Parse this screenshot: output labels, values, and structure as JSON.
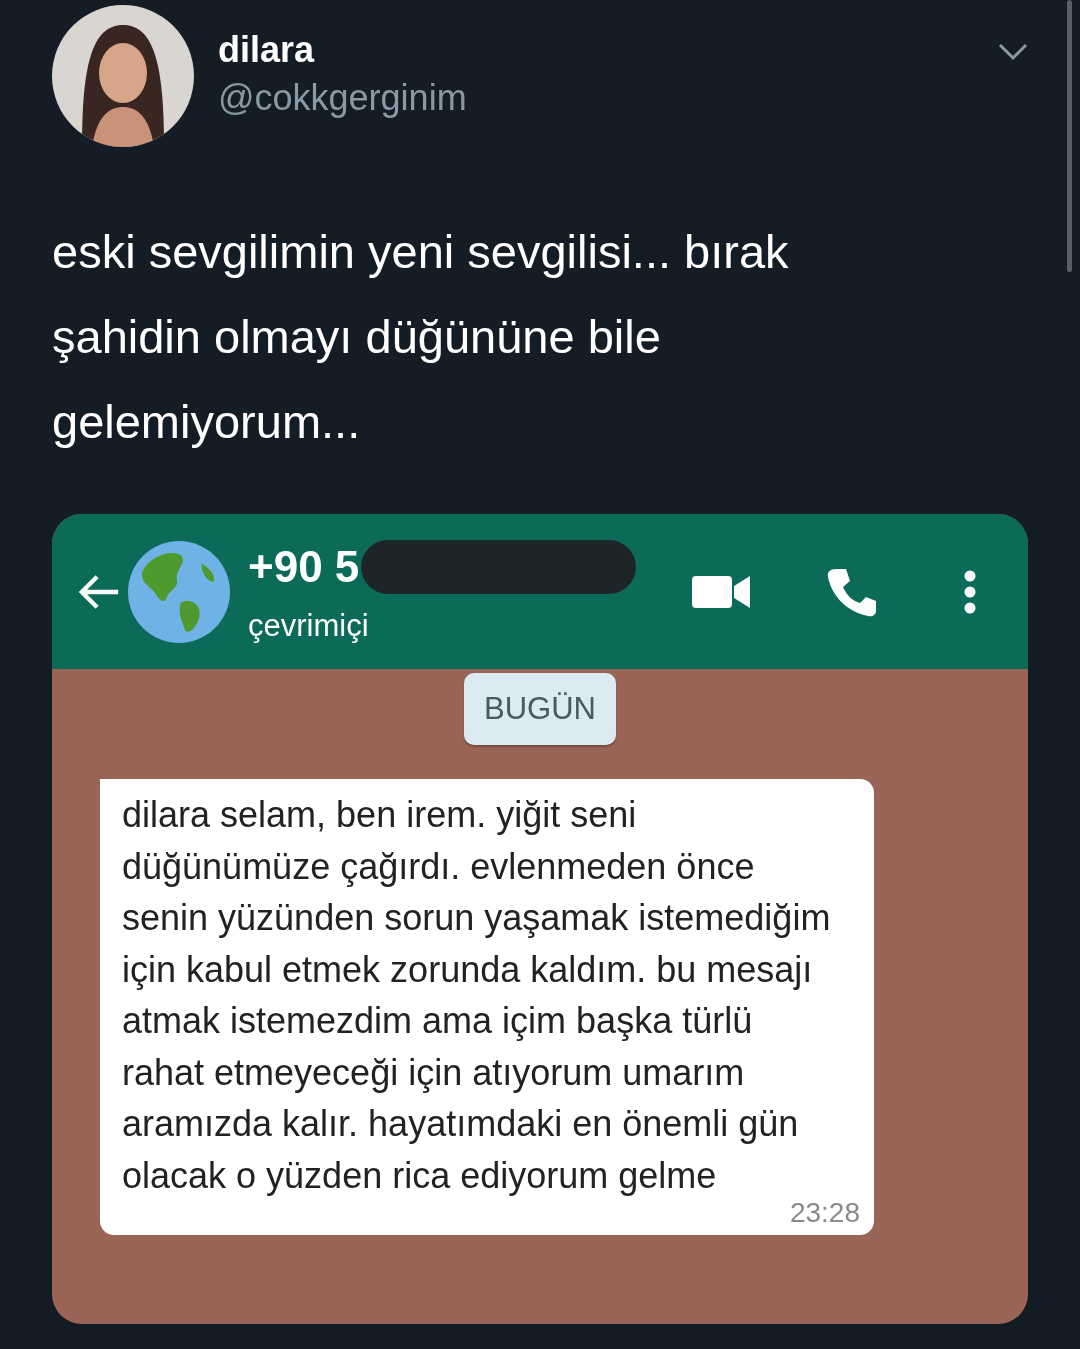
{
  "tweet": {
    "name": "dilara",
    "handle": "@cokkgerginim",
    "text": "eski sevgilimin yeni sevgilisi... bırak şahidin olmayı düğününe bile gelemiyorum..."
  },
  "chat": {
    "contact": "+90 5",
    "status": "çevrimiçi",
    "date_chip": "BUGÜN",
    "messages": [
      {
        "text": "dilara selam, ben irem. yiğit seni düğünümüze çağırdı. evlenmeden önce senin yüzünden sorun yaşamak istemediğim için kabul etmek zorunda kaldım. bu mesajı atmak istemezdim ama içim başka türlü rahat etmeyeceği için atıyorum umarım aramızda kalır. hayatımdaki en önemli gün olacak o yüzden rica ediyorum gelme",
        "time": "23:28"
      }
    ]
  }
}
